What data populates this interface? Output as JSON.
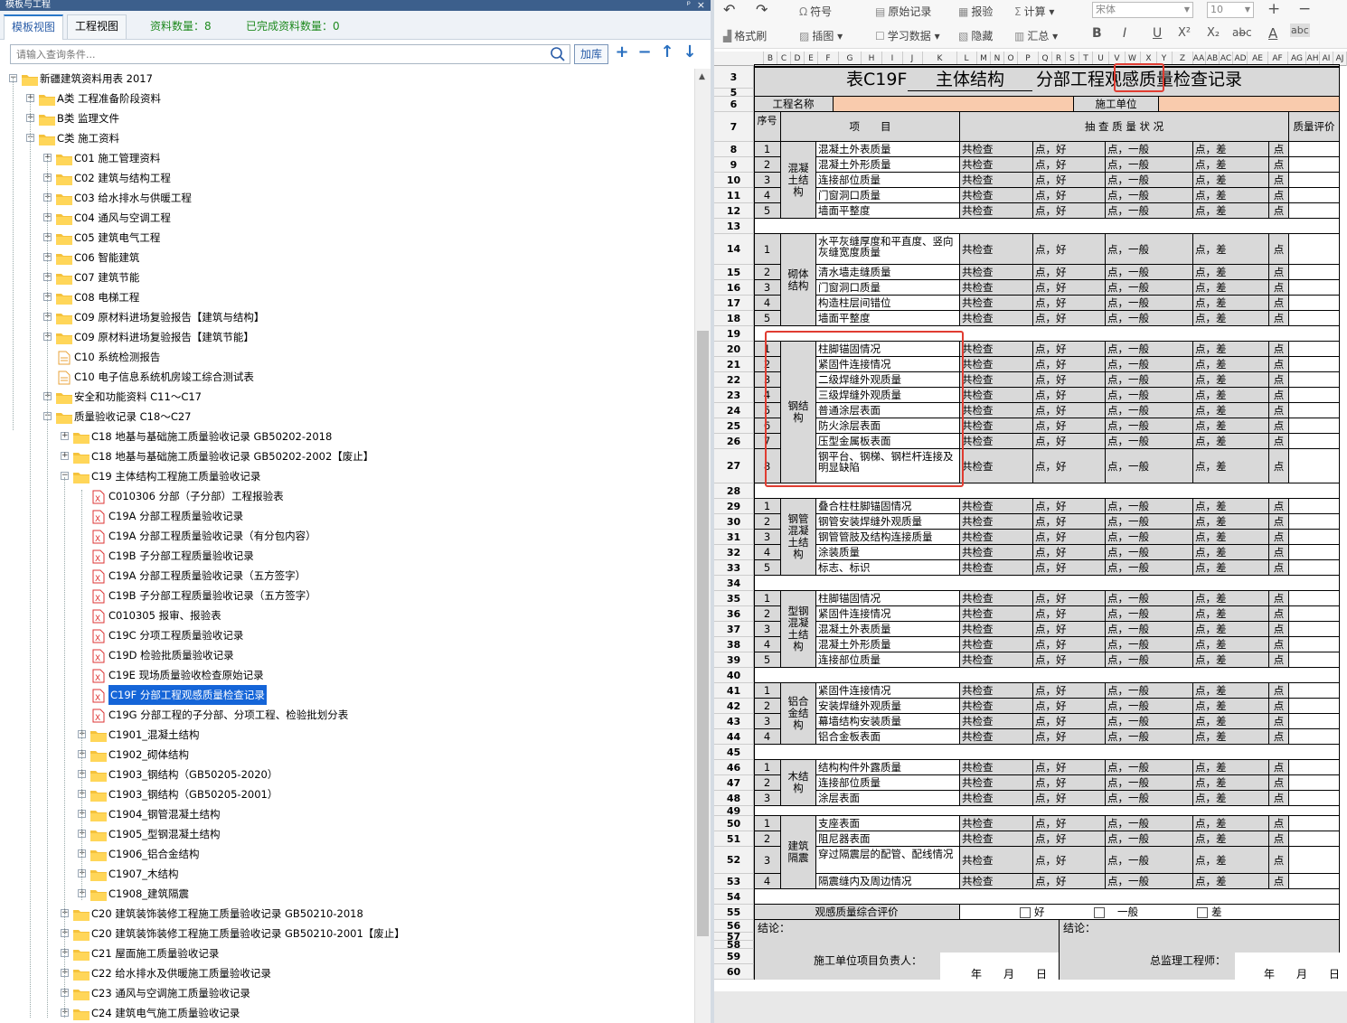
{
  "panel": {
    "title": "模板与工程",
    "pin": "ᵖ",
    "close": "×"
  },
  "tabs": [
    {
      "label": "模板视图"
    },
    {
      "label": "工程视图"
    }
  ],
  "stats": {
    "count": "资料数量：8",
    "done": "已完成资料数量：0"
  },
  "search": {
    "placeholder": "请输入查询条件...",
    "add_label": "加库"
  },
  "tree": [
    {
      "level": 0,
      "label": "新疆建筑资料用表 2017",
      "type": "folder",
      "exp": "-"
    },
    {
      "level": 1,
      "label": "A类 工程准备阶段资料",
      "type": "folder",
      "exp": "+"
    },
    {
      "level": 1,
      "label": "B类 监理文件",
      "type": "folder",
      "exp": "+"
    },
    {
      "level": 1,
      "label": "C类 施工资料",
      "type": "folder",
      "exp": "-"
    },
    {
      "level": 2,
      "label": "C01 施工管理资料",
      "type": "folder",
      "exp": "+"
    },
    {
      "level": 2,
      "label": "C02 建筑与结构工程",
      "type": "folder",
      "exp": "+"
    },
    {
      "level": 2,
      "label": "C03 给水排水与供暖工程",
      "type": "folder",
      "exp": "+"
    },
    {
      "level": 2,
      "label": "C04 通风与空调工程",
      "type": "folder",
      "exp": "+"
    },
    {
      "level": 2,
      "label": "C05 建筑电气工程",
      "type": "folder",
      "exp": "+"
    },
    {
      "level": 2,
      "label": "C06 智能建筑",
      "type": "folder",
      "exp": "+"
    },
    {
      "level": 2,
      "label": "C07 建筑节能",
      "type": "folder",
      "exp": "+"
    },
    {
      "level": 2,
      "label": "C08 电梯工程",
      "type": "folder",
      "exp": "+"
    },
    {
      "level": 2,
      "label": "C09 原材料进场复验报告【建筑与结构】",
      "type": "folder",
      "exp": "+"
    },
    {
      "level": 2,
      "label": "C09 原材料进场复验报告【建筑节能】",
      "type": "folder",
      "exp": "+"
    },
    {
      "level": 2,
      "label": "C10 系统检测报告",
      "type": "doc",
      "exp": ""
    },
    {
      "level": 2,
      "label": "C10 电子信息系统机房竣工综合测试表",
      "type": "doc",
      "exp": ""
    },
    {
      "level": 2,
      "label": "安全和功能资料 C11～C17",
      "type": "folder",
      "exp": "+"
    },
    {
      "level": 2,
      "label": "质量验收记录 C18～C27",
      "type": "folder",
      "exp": "-"
    },
    {
      "level": 3,
      "label": "C18 地基与基础施工质量验收记录 GB50202-2018",
      "type": "folder",
      "exp": "+"
    },
    {
      "level": 3,
      "label": "C18 地基与基础施工质量验收记录 GB50202-2002【废止】",
      "type": "folder",
      "exp": "+"
    },
    {
      "level": 3,
      "label": "C19 主体结构工程施工质量验收记录",
      "type": "folder",
      "exp": "-"
    },
    {
      "level": 4,
      "label": "C010306 分部（子分部）工程报验表",
      "type": "xls",
      "exp": ""
    },
    {
      "level": 4,
      "label": "C19A 分部工程质量验收记录",
      "type": "xls",
      "exp": ""
    },
    {
      "level": 4,
      "label": "C19A 分部工程质量验收记录（有分包内容）",
      "type": "xls",
      "exp": ""
    },
    {
      "level": 4,
      "label": "C19B 子分部工程质量验收记录",
      "type": "xls",
      "exp": ""
    },
    {
      "level": 4,
      "label": "C19A 分部工程质量验收记录（五方签字）",
      "type": "xls",
      "exp": ""
    },
    {
      "level": 4,
      "label": "C19B 子分部工程质量验收记录（五方签字）",
      "type": "xls",
      "exp": ""
    },
    {
      "level": 4,
      "label": "C010305 报审、报验表",
      "type": "xls",
      "exp": ""
    },
    {
      "level": 4,
      "label": "C19C 分项工程质量验收记录",
      "type": "xls",
      "exp": ""
    },
    {
      "level": 4,
      "label": "C19D 检验批质量验收记录",
      "type": "xls",
      "exp": ""
    },
    {
      "level": 4,
      "label": "C19E 现场质量验收检查原始记录",
      "type": "xls",
      "exp": ""
    },
    {
      "level": 4,
      "label": "C19F 分部工程观感质量检查记录",
      "type": "xls",
      "exp": "",
      "selected": true
    },
    {
      "level": 4,
      "label": "C19G 分部工程的子分部、分项工程、检验批划分表",
      "type": "xls",
      "exp": ""
    },
    {
      "level": 4,
      "label": "C1901_混凝土结构",
      "type": "folder",
      "exp": "+"
    },
    {
      "level": 4,
      "label": "C1902_砌体结构",
      "type": "folder",
      "exp": "+"
    },
    {
      "level": 4,
      "label": "C1903_钢结构（GB50205-2020）",
      "type": "folder",
      "exp": "+"
    },
    {
      "level": 4,
      "label": "C1903_钢结构（GB50205-2001）",
      "type": "folder",
      "exp": "+"
    },
    {
      "level": 4,
      "label": "C1904_钢管混凝土结构",
      "type": "folder",
      "exp": "+"
    },
    {
      "level": 4,
      "label": "C1905_型钢混凝土结构",
      "type": "folder",
      "exp": "+"
    },
    {
      "level": 4,
      "label": "C1906_铝合金结构",
      "type": "folder",
      "exp": "+"
    },
    {
      "level": 4,
      "label": "C1907_木结构",
      "type": "folder",
      "exp": "+"
    },
    {
      "level": 4,
      "label": "C1908_建筑隔震",
      "type": "folder",
      "exp": "+"
    },
    {
      "level": 3,
      "label": "C20 建筑装饰装修工程施工质量验收记录 GB50210-2018",
      "type": "folder",
      "exp": "+"
    },
    {
      "level": 3,
      "label": "C20 建筑装饰装修工程施工质量验收记录 GB50210-2001【废止】",
      "type": "folder",
      "exp": "+"
    },
    {
      "level": 3,
      "label": "C21 屋面施工质量验收记录",
      "type": "folder",
      "exp": "+"
    },
    {
      "level": 3,
      "label": "C22 给水排水及供暖施工质量验收记录",
      "type": "folder",
      "exp": "+"
    },
    {
      "level": 3,
      "label": "C23 通风与空调施工质量验收记录",
      "type": "folder",
      "exp": "+"
    },
    {
      "level": 3,
      "label": "C24 建筑电气施工质量验收记录",
      "type": "folder",
      "exp": "+"
    }
  ],
  "toolbar": {
    "undo": "↶",
    "redo": "↷",
    "symbol": "符号",
    "orig_record": "原始记录",
    "report": "报验",
    "calc": "计算 ▾",
    "format_brush": "格式刷",
    "insert_pic": "插图 ▾",
    "study_data": "学习数据 ▾",
    "hide": "隐藏",
    "summary": "汇总 ▾",
    "font": "宋体",
    "font_size": "10",
    "bold": "B",
    "italic": "I",
    "underline": "U",
    "sup": "X²",
    "sub": "X₂",
    "strike": "ab̶c",
    "fontcolor": "A",
    "clear": "abc"
  },
  "columns": [
    "B",
    "C",
    "D",
    "E",
    "F",
    "G",
    "H",
    "I",
    "J",
    "K",
    "L",
    "M",
    "N",
    "O",
    "P",
    "Q",
    "R",
    "S",
    "T",
    "U",
    "V",
    "W",
    "X",
    "Y",
    "Z",
    "AA",
    "AB",
    "AC",
    "AD",
    "AE",
    "AF",
    "AG",
    "AH",
    "AI",
    "AJ"
  ],
  "form": {
    "title_prefix": "表C19F",
    "title_sub": "主体结构",
    "title_main": "分部工程观感质量检查记录",
    "project_name": "工程名称",
    "constructor": "施工单位",
    "h_seq": "序号",
    "h_item": "项　　目",
    "h_check": "抽 查 质 量 状 况",
    "h_eval": "质量评价",
    "c_total": "共检查",
    "c_good": "点，好",
    "c_normal": "点，一般",
    "c_bad": "点，差",
    "c_pt": "点",
    "overall": "观感质量综合评价",
    "opt_good": "好",
    "opt_normal": "一般",
    "opt_bad": "差",
    "conclusion": "结论：",
    "sign_left": "施工单位项目负责人：",
    "sign_right": "总监理工程师：",
    "date": "年　　月　　日"
  },
  "rows": [
    {
      "r": "1",
      "h": 0
    },
    {
      "r": "2",
      "h": 0
    },
    {
      "r": "3",
      "h": 25
    },
    {
      "r": "4",
      "h": 0
    },
    {
      "r": "5",
      "h": 9
    },
    {
      "r": "6",
      "h": 17
    },
    {
      "r": "7",
      "h": 33
    },
    {
      "r": "8",
      "h": 17,
      "seq": "1",
      "item": "混凝土外表质量",
      "chk": true
    },
    {
      "r": "9",
      "h": 17,
      "seq": "2",
      "item": "混凝土外形质量",
      "chk": true
    },
    {
      "r": "10",
      "h": 17,
      "seq": "3",
      "item": "连接部位质量",
      "chk": true
    },
    {
      "r": "11",
      "h": 17,
      "seq": "4",
      "item": "门窗洞口质量",
      "chk": true
    },
    {
      "r": "12",
      "h": 17,
      "seq": "5",
      "item": "墙面平整度",
      "chk": true
    },
    {
      "r": "13",
      "h": 17
    },
    {
      "r": "14",
      "h": 34,
      "seq": "1",
      "item": "水平灰缝厚度和平直度、竖向灰缝宽度质量",
      "chk": true
    },
    {
      "r": "15",
      "h": 17,
      "seq": "2",
      "item": "清水墙走缝质量",
      "chk": true
    },
    {
      "r": "16",
      "h": 17,
      "seq": "3",
      "item": "门窗洞口质量",
      "chk": true
    },
    {
      "r": "17",
      "h": 17,
      "seq": "4",
      "item": "构造柱层间错位",
      "chk": true
    },
    {
      "r": "18",
      "h": 17,
      "seq": "5",
      "item": "墙面平整度",
      "chk": true
    },
    {
      "r": "19",
      "h": 17
    },
    {
      "r": "20",
      "h": 17,
      "seq": "1",
      "item": "柱脚锚固情况",
      "chk": true
    },
    {
      "r": "21",
      "h": 17,
      "seq": "2",
      "item": "紧固件连接情况",
      "chk": true
    },
    {
      "r": "22",
      "h": 17,
      "seq": "3",
      "item": "二级焊缝外观质量",
      "chk": true
    },
    {
      "r": "23",
      "h": 17,
      "seq": "4",
      "item": "三级焊缝外观质量",
      "chk": true
    },
    {
      "r": "24",
      "h": 17,
      "seq": "5",
      "item": "普通涂层表面",
      "chk": true
    },
    {
      "r": "25",
      "h": 17,
      "seq": "6",
      "item": "防火涂层表面",
      "chk": true
    },
    {
      "r": "26",
      "h": 17,
      "seq": "7",
      "item": "压型金属板表面",
      "chk": true
    },
    {
      "r": "27",
      "h": 38,
      "seq": "8",
      "item": "钢平台、钢梯、钢栏杆连接及明显缺陷",
      "chk": true
    },
    {
      "r": "28",
      "h": 17
    },
    {
      "r": "29",
      "h": 17,
      "seq": "1",
      "item": "叠合柱柱脚锚固情况",
      "chk": true
    },
    {
      "r": "30",
      "h": 17,
      "seq": "2",
      "item": "钢管安装焊缝外观质量",
      "chk": true
    },
    {
      "r": "31",
      "h": 17,
      "seq": "3",
      "item": "钢管管肢及结构连接质量",
      "chk": true
    },
    {
      "r": "32",
      "h": 17,
      "seq": "4",
      "item": "涂装质量",
      "chk": true
    },
    {
      "r": "33",
      "h": 17,
      "seq": "5",
      "item": "标志、标识",
      "chk": true
    },
    {
      "r": "34",
      "h": 17
    },
    {
      "r": "35",
      "h": 17,
      "seq": "1",
      "item": "柱脚锚固情况",
      "chk": true
    },
    {
      "r": "36",
      "h": 17,
      "seq": "2",
      "item": "紧固件连接情况",
      "chk": true
    },
    {
      "r": "37",
      "h": 17,
      "seq": "3",
      "item": "混凝土外表质量",
      "chk": true
    },
    {
      "r": "38",
      "h": 17,
      "seq": "4",
      "item": "混凝土外形质量",
      "chk": true
    },
    {
      "r": "39",
      "h": 17,
      "seq": "5",
      "item": "连接部位质量",
      "chk": true
    },
    {
      "r": "40",
      "h": 17
    },
    {
      "r": "41",
      "h": 17,
      "seq": "1",
      "item": "紧固件连接情况",
      "chk": true
    },
    {
      "r": "42",
      "h": 17,
      "seq": "2",
      "item": "安装焊缝外观质量",
      "chk": true
    },
    {
      "r": "43",
      "h": 17,
      "seq": "3",
      "item": "幕墙结构安装质量",
      "chk": true
    },
    {
      "r": "44",
      "h": 17,
      "seq": "4",
      "item": "铝合金板表面",
      "chk": true
    },
    {
      "r": "45",
      "h": 17
    },
    {
      "r": "46",
      "h": 17,
      "seq": "1",
      "item": "结构构件外露质量",
      "chk": true
    },
    {
      "r": "47",
      "h": 17,
      "seq": "2",
      "item": "连接部位质量",
      "chk": true
    },
    {
      "r": "48",
      "h": 17,
      "seq": "3",
      "item": "涂层表面",
      "chk": true
    },
    {
      "r": "49",
      "h": 11
    },
    {
      "r": "50",
      "h": 17,
      "seq": "1",
      "item": "支座表面",
      "chk": true
    },
    {
      "r": "51",
      "h": 17,
      "seq": "2",
      "item": "阻尼器表面",
      "chk": true
    },
    {
      "r": "52",
      "h": 30,
      "seq": "3",
      "item": "穿过隔震层的配管、配线情况",
      "chk": true
    },
    {
      "r": "53",
      "h": 17,
      "seq": "4",
      "item": "隔震缝内及周边情况",
      "chk": true
    },
    {
      "r": "54",
      "h": 17
    },
    {
      "r": "55",
      "h": 17
    },
    {
      "r": "56",
      "h": 14
    },
    {
      "r": "57",
      "h": 9
    },
    {
      "r": "58",
      "h": 9
    },
    {
      "r": "59",
      "h": 17
    },
    {
      "r": "60",
      "h": 17
    }
  ],
  "groups": [
    {
      "label": "混凝土结构",
      "from": "8",
      "to": "12"
    },
    {
      "label": "砌体结构",
      "from": "14",
      "to": "18"
    },
    {
      "label": "钢结构",
      "from": "20",
      "to": "27"
    },
    {
      "label": "钢管混凝土结构",
      "from": "29",
      "to": "33"
    },
    {
      "label": "型钢混凝土结构",
      "from": "35",
      "to": "39"
    },
    {
      "label": "铝合金结构",
      "from": "41",
      "to": "44"
    },
    {
      "label": "木结构",
      "from": "46",
      "to": "48"
    },
    {
      "label": "建筑隔震",
      "from": "50",
      "to": "53"
    }
  ]
}
